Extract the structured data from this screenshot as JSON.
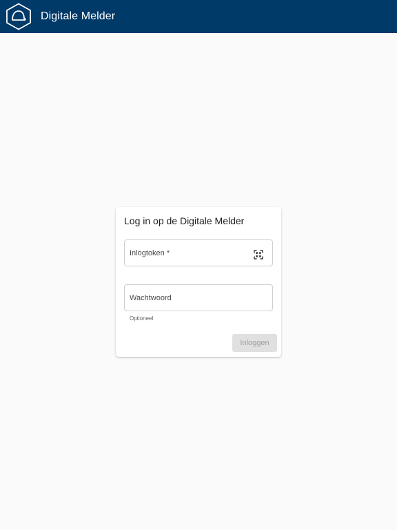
{
  "app_bar": {
    "title": "Digitale Melder",
    "logo_icon": "hexagon-helmet-icon",
    "background_color": "#003a69"
  },
  "login_card": {
    "title": "Log in op de Digitale Melder",
    "token_field": {
      "label": "Inlogtoken *",
      "value": "",
      "icon": "qr-code-scan-icon"
    },
    "password_field": {
      "label": "Wachtwoord",
      "value": "",
      "helper_text": "Optioneel"
    },
    "submit_label": "Inloggen",
    "submit_disabled": true
  }
}
